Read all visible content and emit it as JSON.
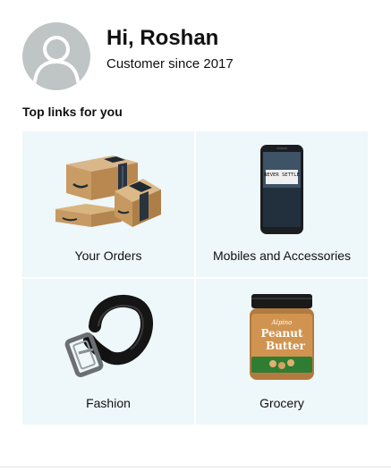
{
  "profile": {
    "greeting": "Hi, Roshan",
    "member_since": "Customer since 2017",
    "avatar_icon": "user-silhouette-icon"
  },
  "section": {
    "title": "Top links for you"
  },
  "links": [
    {
      "label": "Your Orders",
      "icon": "package-boxes-image"
    },
    {
      "label": "Mobiles and Accessories",
      "icon": "smartphone-image"
    },
    {
      "label": "Fashion",
      "icon": "belt-image"
    },
    {
      "label": "Grocery",
      "icon": "peanut-butter-jar-image"
    }
  ],
  "product_image_text": {
    "phone_screen": "NEVER SETTLE",
    "jar_brand": "Alpino",
    "jar_line1": "Peanut",
    "jar_line2": "Butter"
  },
  "colors": {
    "tile_background": "#eef7f9",
    "avatar_background": "#bfc4c4",
    "text": "#111111"
  }
}
